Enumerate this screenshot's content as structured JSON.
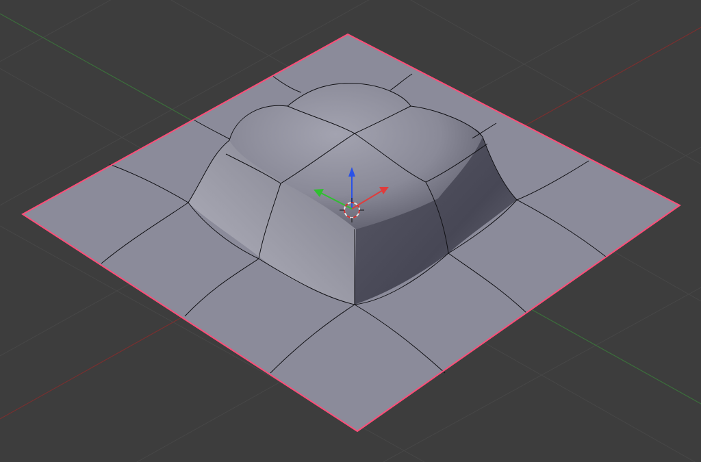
{
  "viewport": {
    "background": "#3d3d3d",
    "grid_color": "#494949",
    "x_axis_color": "#8a2f2f",
    "y_axis_color": "#3f7a3f",
    "mesh_fill": "#8b8b9a",
    "mesh_highlight": "#aeaebb",
    "mesh_shadow": "#4a4a58",
    "wire_color": "#101014",
    "selection_outline": "#ff4d78"
  },
  "gizmo": {
    "x_color": "#e03c3c",
    "y_color": "#30c030",
    "z_color": "#2a52e8",
    "cursor_ring": "#e6e6e6",
    "cursor_dash": "#d03030"
  }
}
